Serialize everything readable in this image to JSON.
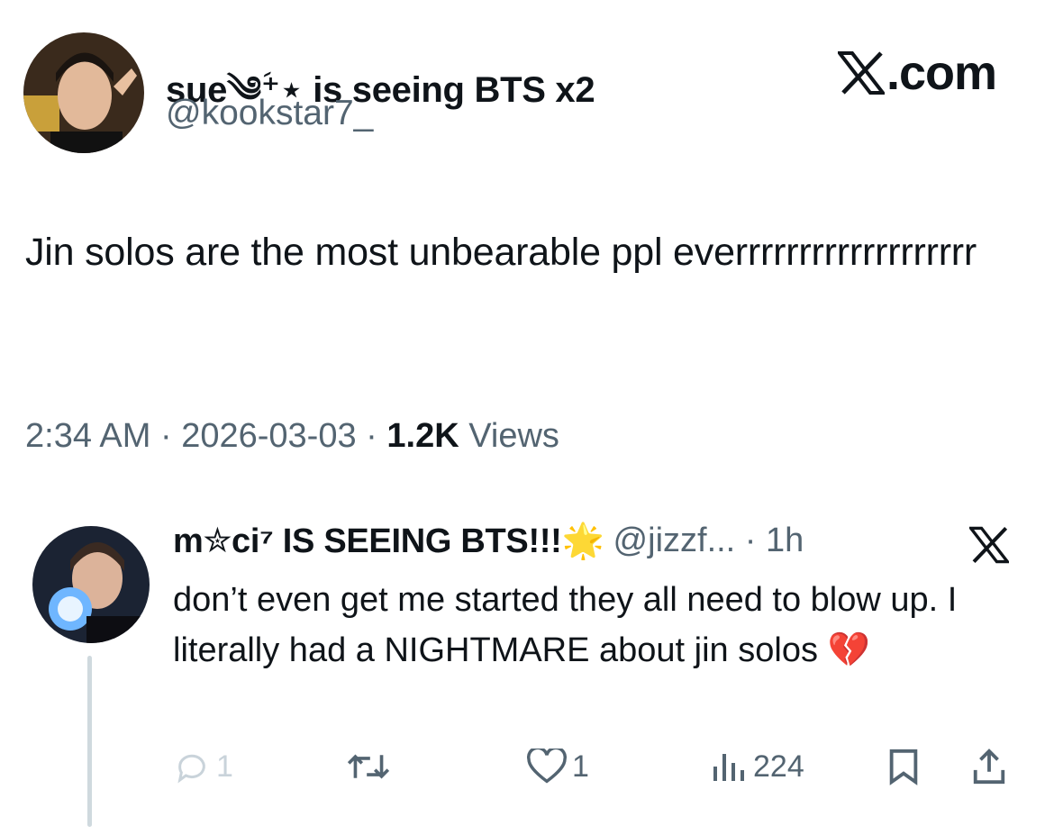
{
  "tweet": {
    "display_name": "sue༄ؘ⁺⋆ is seeing BTS x2",
    "handle": "@kookstar7_",
    "brand": ".com",
    "text": "Jin solos are the most unbearable ppl everrrrrrrrrrrrrrrrrrr",
    "time": "2:34 AM",
    "date": "2026-03-03",
    "views_count": "1.2K",
    "views_label": "Views"
  },
  "reply": {
    "display_name": "m✮ci⁷ IS SEEING BTS!!!🌟",
    "handle": "@jizzf... · 1h",
    "text": "don’t even get me started they all need to blow up. I literally had a NIGHTMARE about jin solos 💔",
    "replies": "1",
    "likes": "1",
    "views": "224"
  },
  "icons": {
    "brand": "x-logo-icon",
    "reply_brand": "x-logo-icon",
    "reply": "comment-icon",
    "retweet": "retweet-icon",
    "like": "heart-icon",
    "views": "views-chart-icon",
    "bookmark": "bookmark-icon",
    "share": "share-icon"
  },
  "colors": {
    "text": "#0f1419",
    "secondary": "#536471",
    "thread_line": "#cfd9de"
  }
}
